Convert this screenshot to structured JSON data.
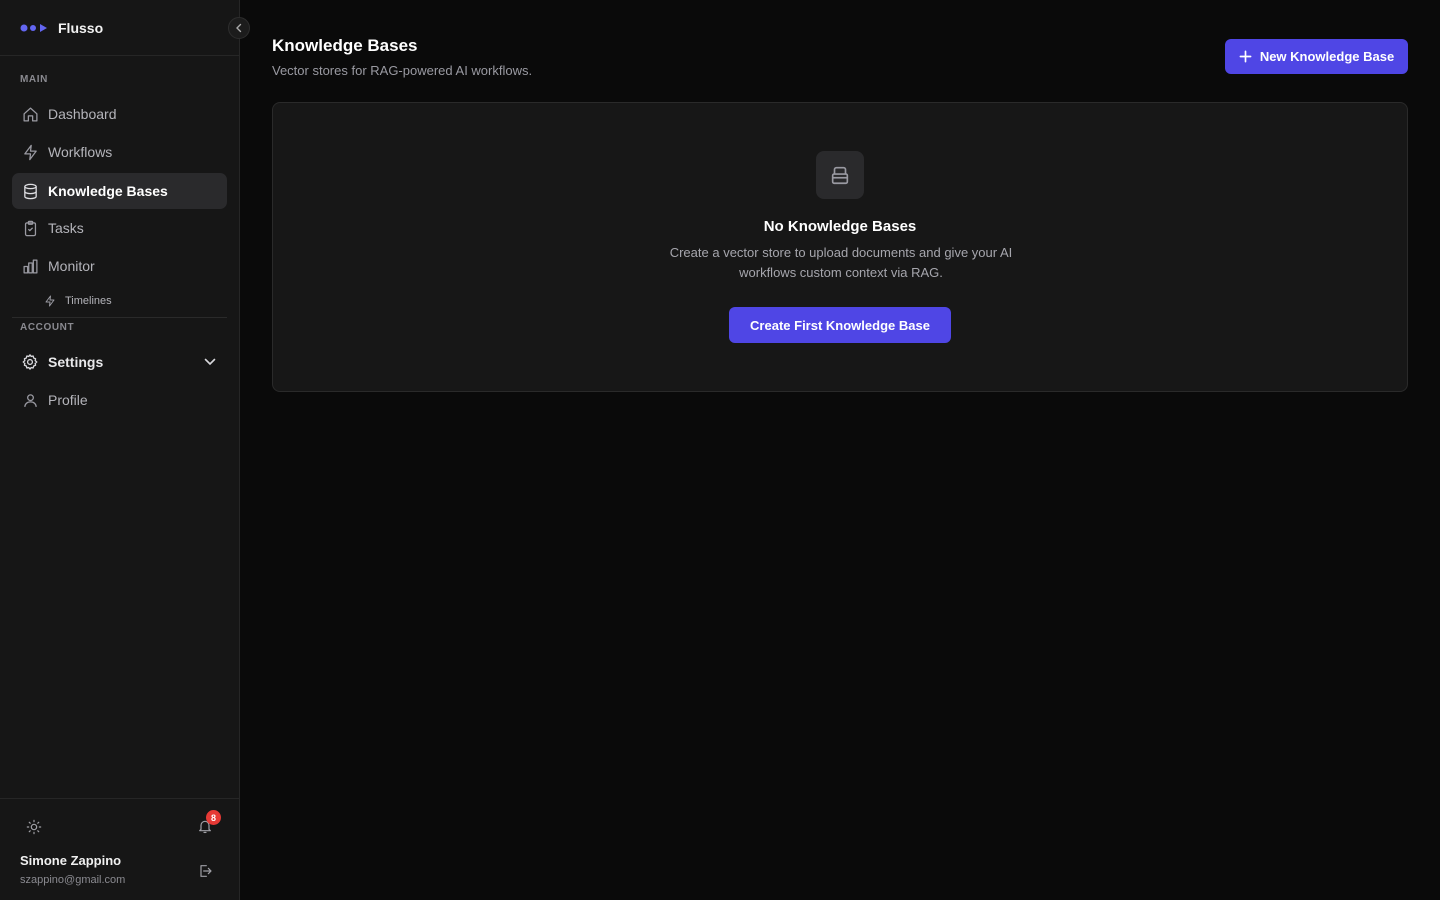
{
  "app": {
    "name": "Flusso"
  },
  "sidebar": {
    "sections": {
      "main": "MAIN",
      "account": "ACCOUNT"
    },
    "items": [
      {
        "label": "Dashboard",
        "icon": "home-icon"
      },
      {
        "label": "Workflows",
        "icon": "bolt-icon"
      },
      {
        "label": "Knowledge Bases",
        "icon": "database-icon",
        "active": true
      },
      {
        "label": "Tasks",
        "icon": "clipboard-check-icon"
      },
      {
        "label": "Monitor",
        "icon": "bar-chart-icon"
      }
    ],
    "sub_item": {
      "label": "Timelines",
      "icon": "bolt-icon"
    },
    "account_items": [
      {
        "label": "Settings",
        "icon": "gear-icon"
      },
      {
        "label": "Profile",
        "icon": "user-icon"
      }
    ]
  },
  "footer": {
    "notifications_count": "8",
    "user_name": "Simone Zappino",
    "user_email": "szappino@gmail.com"
  },
  "main": {
    "title": "Knowledge Bases",
    "subtitle": "Vector stores for RAG-powered AI workflows.",
    "new_button": "New Knowledge Base",
    "empty_state": {
      "title": "No Knowledge Bases",
      "description": "Create a vector store to upload documents and give your AI workflows custom context via RAG.",
      "cta": "Create First Knowledge Base"
    }
  },
  "colors": {
    "accent": "#4f46e5",
    "badge": "#e53935",
    "background": "#0a0a0a",
    "sidebar": "#161616"
  }
}
